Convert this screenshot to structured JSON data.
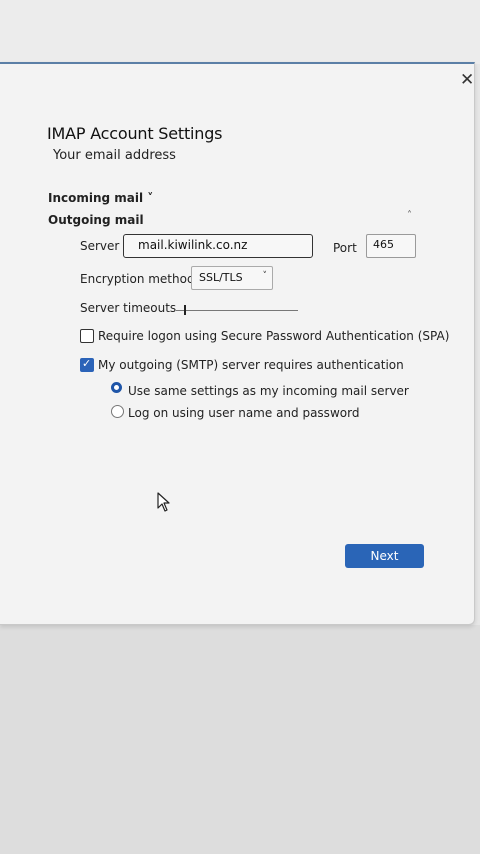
{
  "dialog": {
    "title": "IMAP Account Settings",
    "email_subtitle": "Your email address",
    "close_label": "✕"
  },
  "sections": {
    "incoming": "Incoming mail ˅",
    "outgoing": "Outgoing mail",
    "outgoing_caret": "˄"
  },
  "outgoing": {
    "server_label": "Server",
    "server_value": "mail.kiwilink.co.nz",
    "port_label": "Port",
    "port_value": "465",
    "encryption_label": "Encryption method",
    "encryption_value": "SSL/TLS",
    "encryption_chevron": "˅",
    "timeouts_label": "Server timeouts",
    "timeout_level": 0.07,
    "spa_label": "Require logon using Secure Password Authentication (SPA)",
    "spa_checked": false,
    "auth_label": "My outgoing (SMTP) server requires authentication",
    "auth_checked": true,
    "auth_check_glyph": "✓",
    "radio_same_label": "Use same settings as my incoming mail server",
    "radio_logon_label": "Log on using user name and password",
    "selected_radio": "same"
  },
  "footer": {
    "next_label": "Next"
  },
  "colors": {
    "accent": "#2a65b7",
    "dialog_bg": "#f3f3f3",
    "border_top": "#5b7fa6"
  },
  "icons": {
    "close": "close-icon",
    "cursor": "mouse-pointer-icon"
  }
}
